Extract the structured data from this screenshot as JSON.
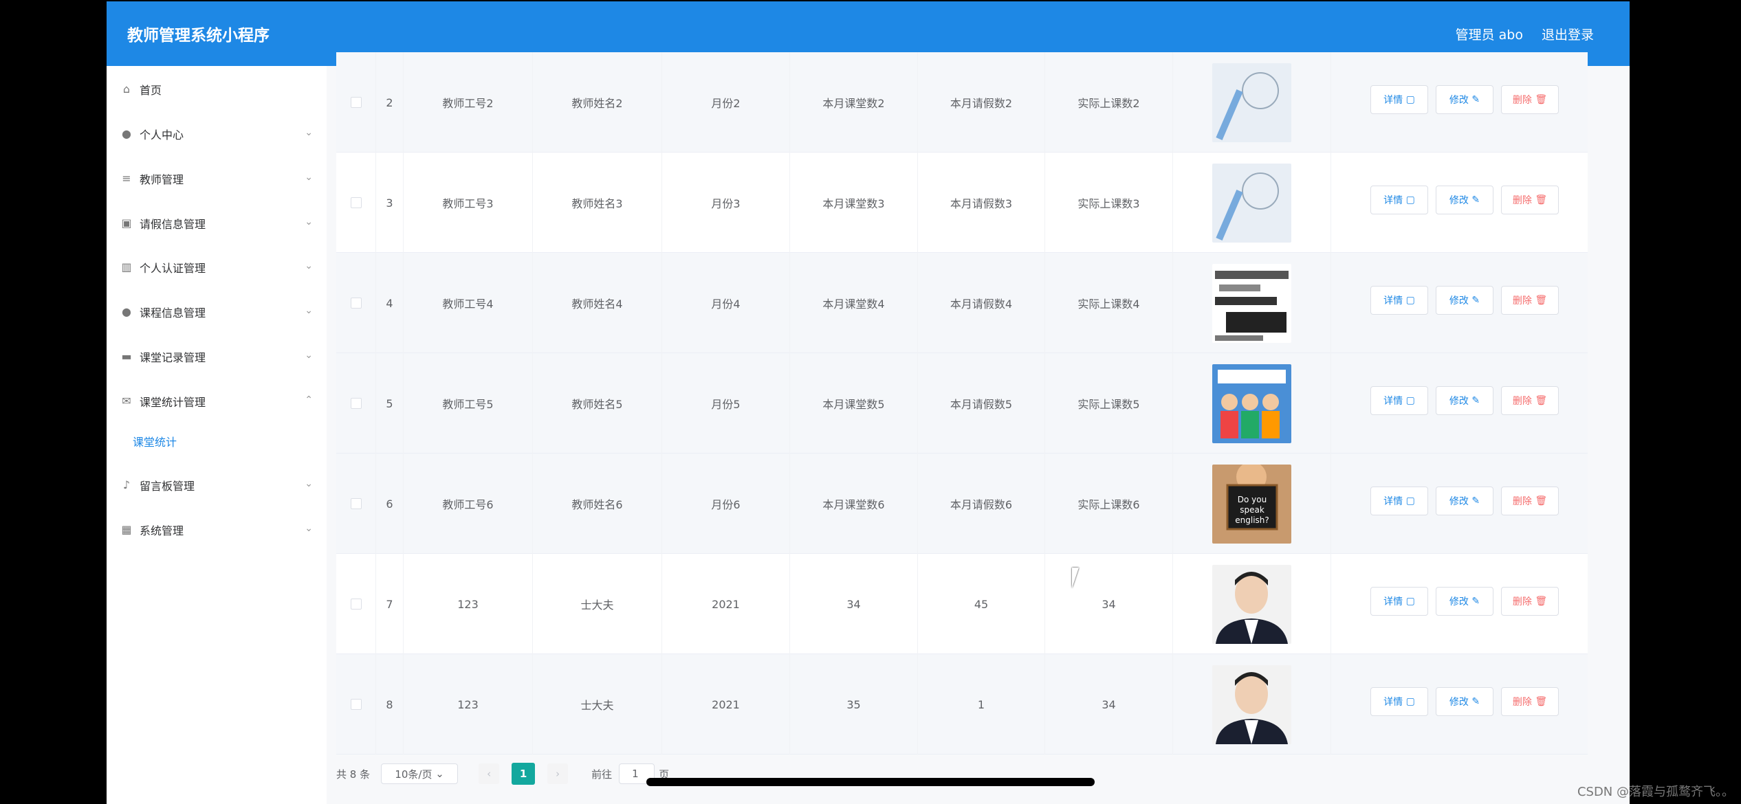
{
  "app": {
    "title": "教师管理系统小程序",
    "user": "管理员 abo",
    "logout": "退出登录"
  },
  "sidebar": {
    "items": [
      {
        "icon": "home-icon",
        "label": "首页"
      },
      {
        "icon": "user-icon",
        "label": "个人中心"
      },
      {
        "icon": "list-icon",
        "label": "教师管理"
      },
      {
        "icon": "clipboard-icon",
        "label": "请假信息管理"
      },
      {
        "icon": "bars-icon",
        "label": "个人认证管理"
      },
      {
        "icon": "user-icon",
        "label": "课程信息管理"
      },
      {
        "icon": "monitor-icon",
        "label": "课堂记录管理"
      },
      {
        "icon": "mail-icon",
        "label": "课堂统计管理"
      },
      {
        "icon": "mic-icon",
        "label": "留言板管理"
      },
      {
        "icon": "grid-icon",
        "label": "系统管理"
      }
    ],
    "submenu": "课堂统计"
  },
  "table": {
    "rows": [
      {
        "idx": "2",
        "id": "教师工号2",
        "name": "教师姓名2",
        "month": "月份2",
        "planned": "本月课堂数2",
        "leave": "本月请假数2",
        "actual": "实际上课数2"
      },
      {
        "idx": "3",
        "id": "教师工号3",
        "name": "教师姓名3",
        "month": "月份3",
        "planned": "本月课堂数3",
        "leave": "本月请假数3",
        "actual": "实际上课数3"
      },
      {
        "idx": "4",
        "id": "教师工号4",
        "name": "教师姓名4",
        "month": "月份4",
        "planned": "本月课堂数4",
        "leave": "本月请假数4",
        "actual": "实际上课数4"
      },
      {
        "idx": "5",
        "id": "教师工号5",
        "name": "教师姓名5",
        "month": "月份5",
        "planned": "本月课堂数5",
        "leave": "本月请假数5",
        "actual": "实际上课数5"
      },
      {
        "idx": "6",
        "id": "教师工号6",
        "name": "教师姓名6",
        "month": "月份6",
        "planned": "本月课堂数6",
        "leave": "本月请假数6",
        "actual": "实际上课数6"
      },
      {
        "idx": "7",
        "id": "123",
        "name": "士大夫",
        "month": "2021",
        "planned": "34",
        "leave": "45",
        "actual": "34"
      },
      {
        "idx": "8",
        "id": "123",
        "name": "士大夫",
        "month": "2021",
        "planned": "35",
        "leave": "1",
        "actual": "34"
      }
    ],
    "buttons": {
      "detail": "详情",
      "edit": "修改",
      "delete": "删除"
    }
  },
  "pager": {
    "total": "共 8 条",
    "size": "10条/页",
    "current": "1",
    "goto": "前往",
    "jump_value": "1",
    "page_suffix": "页"
  },
  "watermark": "CSDN @落霞与孤鹜齐飞。。"
}
